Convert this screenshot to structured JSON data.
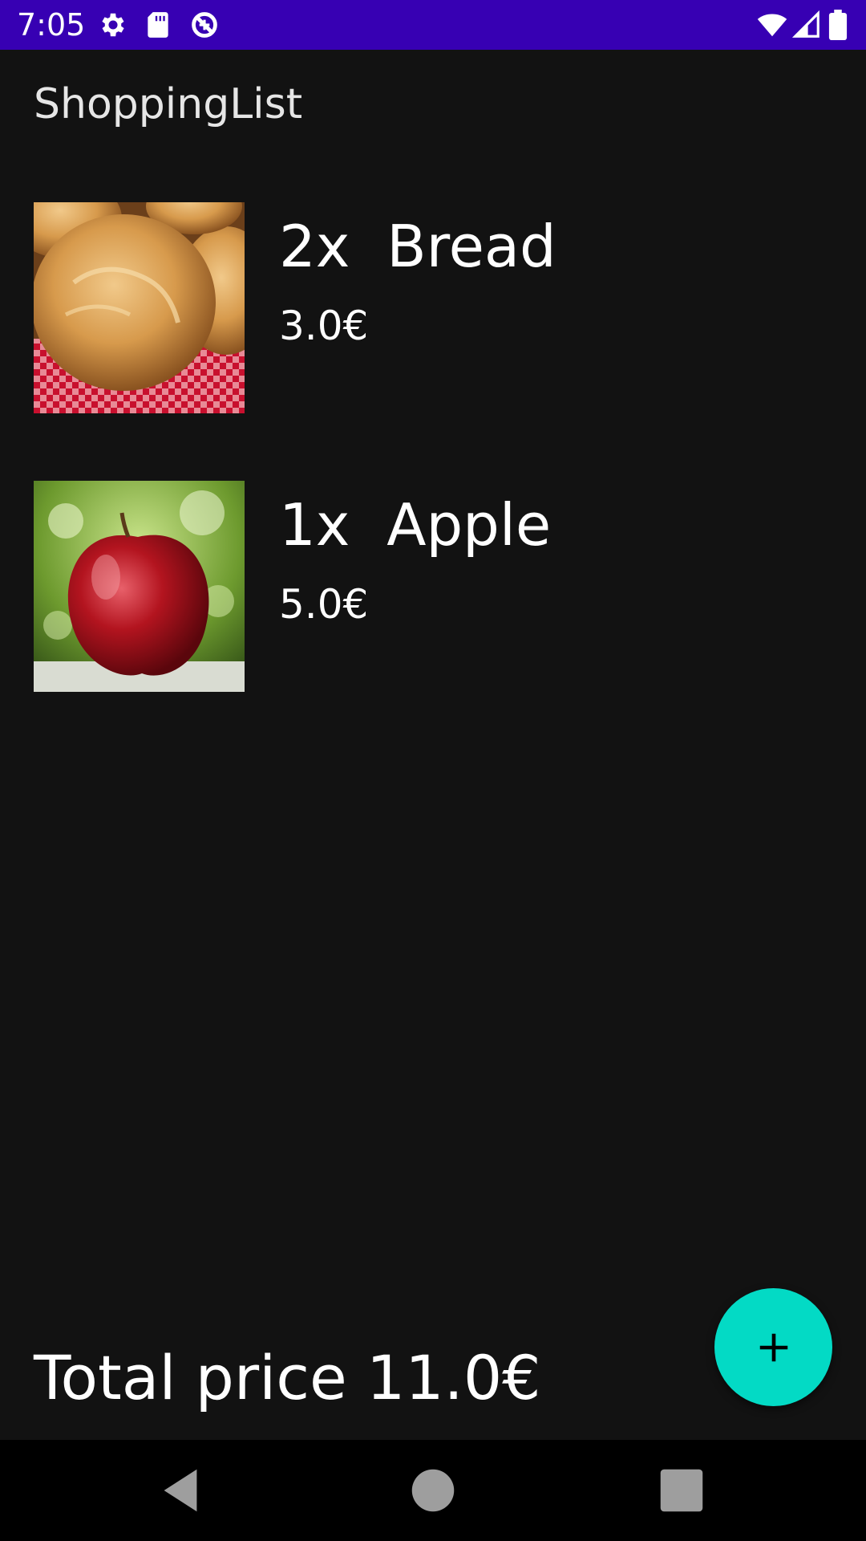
{
  "status_bar": {
    "time": "7:05",
    "background": "#3700b3",
    "icons_left": [
      "gear-icon",
      "sd-card-icon",
      "data-saver-icon"
    ],
    "icons_right": [
      "wifi-icon",
      "signal-icon",
      "battery-icon"
    ]
  },
  "app": {
    "title": "ShoppingList"
  },
  "items": [
    {
      "name_line": "2x  Bread",
      "price": "3.0€",
      "image": "bread"
    },
    {
      "name_line": "1x  Apple",
      "price": "5.0€",
      "image": "apple"
    }
  ],
  "footer": {
    "total_line": "Total price 11.0€"
  },
  "fab": {
    "icon": "plus-icon",
    "color": "#03dac5"
  },
  "nav_bar": {
    "buttons": [
      "back-icon",
      "home-icon",
      "recents-icon"
    ]
  },
  "colors": {
    "background": "#121212",
    "accent": "#03dac5",
    "status": "#3700b3"
  }
}
